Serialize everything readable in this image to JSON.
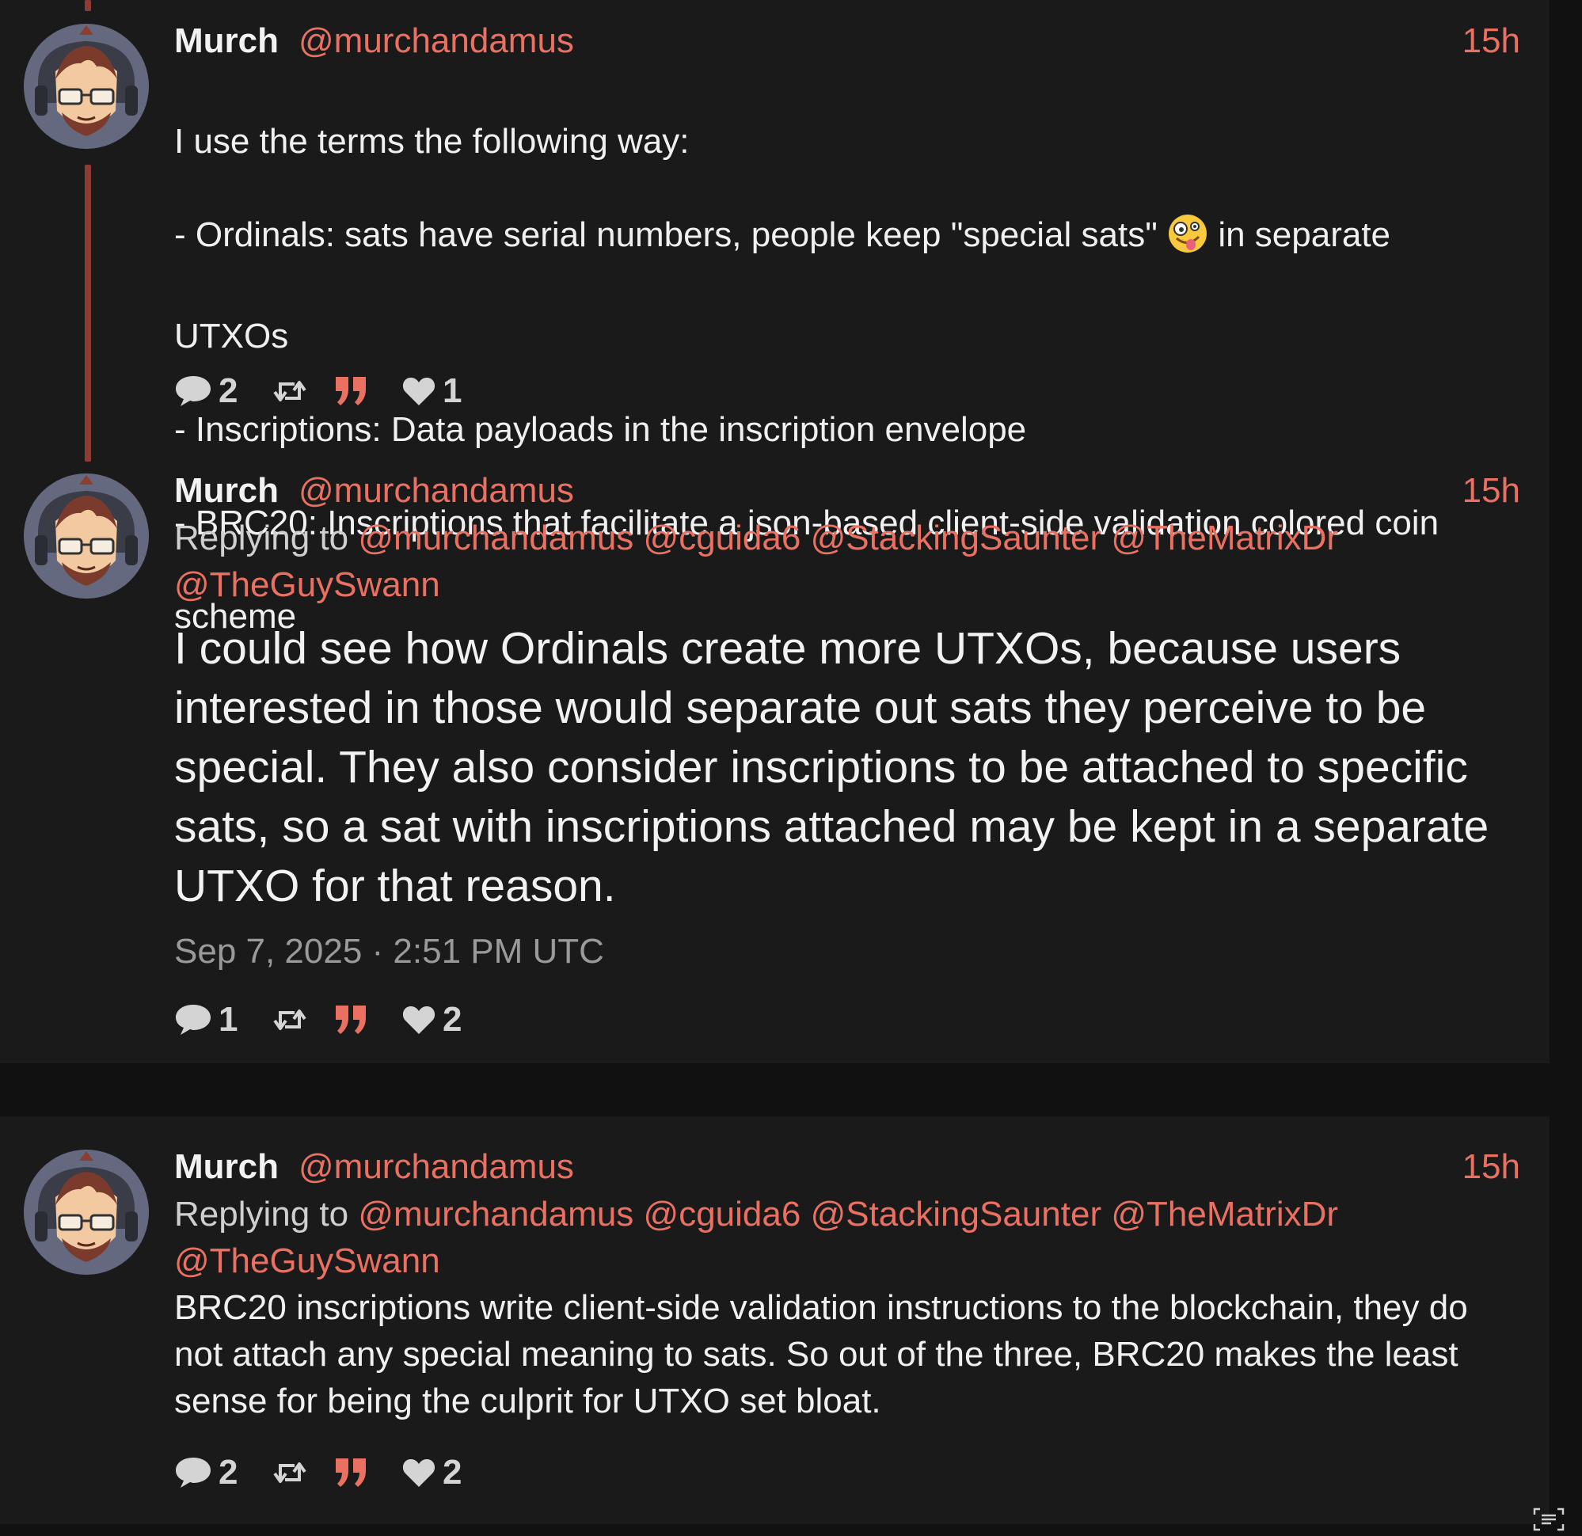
{
  "posts": [
    {
      "author_name": "Murch",
      "author_handle": "@murchandamus",
      "time": "15h",
      "text_lines": {
        "l1": "I use the terms the following way:",
        "l2a": "- Ordinals: sats have serial numbers, people keep \"special sats\"",
        "l2b": "in separate",
        "l3": "UTXOs",
        "l4": "- Inscriptions: Data payloads in the inscription envelope",
        "l5": "- BRC20: Inscriptions that facilitate a json-based client-side validation colored coin",
        "l6": "scheme"
      },
      "emoji": "zany-face",
      "replies": "2",
      "likes": "1"
    },
    {
      "author_name": "Murch",
      "author_handle": "@murchandamus",
      "time": "15h",
      "replying_to_label": "Replying to",
      "replying_to": [
        "@murchandamus",
        "@cguida6",
        "@StackingSaunter",
        "@TheMatrixDr",
        "@TheGuySwann"
      ],
      "text": "I could see how Ordinals create more UTXOs, because users interested in those would separate out sats they perceive to be special. They also consider inscriptions to be attached to specific sats, so a sat with inscriptions attached may be kept in a separate UTXO for that reason.",
      "date": "Sep 7, 2025 · 2:51 PM UTC",
      "replies": "1",
      "likes": "2"
    },
    {
      "author_name": "Murch",
      "author_handle": "@murchandamus",
      "time": "15h",
      "replying_to_label": "Replying to",
      "replying_to": [
        "@murchandamus",
        "@cguida6",
        "@StackingSaunter",
        "@TheMatrixDr",
        "@TheGuySwann"
      ],
      "text": "BRC20 inscriptions write client-side validation instructions to the blockchain, they do not attach any special meaning to sats. So out of the three, BRC20 makes the least sense for being the culprit for UTXO set bloat.",
      "replies": "2",
      "likes": "2"
    }
  ],
  "colors": {
    "accent": "#ea7062",
    "background": "#111111",
    "panel": "#1a1a1a",
    "thread_line": "#8e3b37"
  },
  "icons": [
    "comment-icon",
    "retweet-icon",
    "quote-icon",
    "heart-icon",
    "text-recognition-icon"
  ]
}
